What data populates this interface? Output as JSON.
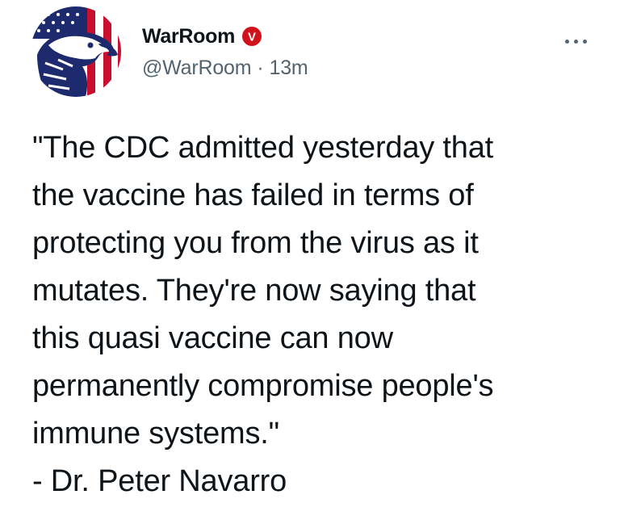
{
  "post": {
    "author": {
      "display_name": "WarRoom",
      "badge_letter": "V",
      "badge_color": "#d0121b",
      "handle": "@WarRoom",
      "separator": "·",
      "timestamp": "13m",
      "avatar_icon": "eagle-flag-icon"
    },
    "more_icon": "more-dots-icon",
    "text_lines": [
      "\"The CDC admitted yesterday that",
      "the vaccine has failed in terms of",
      "protecting you from the virus as it",
      "mutates. They're now saying that",
      "this quasi vaccine can now",
      "permanently compromise people's",
      "immune systems.\"",
      "- Dr. Peter Navarro"
    ]
  },
  "colors": {
    "text_primary": "#0f1419",
    "text_secondary": "#536471",
    "flag_red": "#c8102e",
    "flag_blue": "#1d2a6e"
  }
}
